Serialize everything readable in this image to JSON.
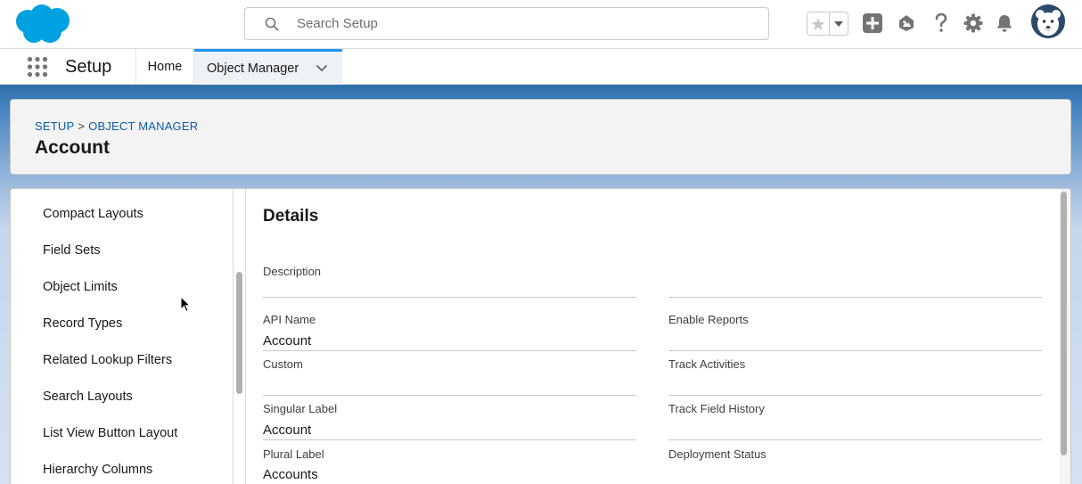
{
  "header": {
    "search": {
      "placeholder": "Search Setup",
      "value": ""
    },
    "icons": [
      "salesforce-cloud-logo",
      "search-icon",
      "star-icon",
      "chevron-down-icon",
      "plus-icon",
      "trailhead-icon",
      "help-icon",
      "gear-icon",
      "bell-icon",
      "bear-avatar"
    ]
  },
  "context": {
    "app_name": "Setup",
    "tabs": [
      {
        "label": "Home"
      },
      {
        "label": "Object Manager"
      }
    ]
  },
  "page_header": {
    "breadcrumb": [
      "SETUP",
      "OBJECT MANAGER"
    ],
    "breadcrumb_sep": ">",
    "title": "Account"
  },
  "sidebar": {
    "items": [
      "Compact Layouts",
      "Field Sets",
      "Object Limits",
      "Record Types",
      "Related Lookup Filters",
      "Search Layouts",
      "List View Button Layout",
      "Hierarchy Columns"
    ]
  },
  "details": {
    "title": "Details",
    "left": [
      {
        "label": "Description",
        "value": ""
      },
      {
        "label": "API Name",
        "value": "Account"
      },
      {
        "label": "Custom",
        "value": ""
      },
      {
        "label": "Singular Label",
        "value": "Account"
      },
      {
        "label": "Plural Label",
        "value": "Accounts"
      }
    ],
    "right": [
      {
        "label": "Enable Reports",
        "value": ""
      },
      {
        "label": "Track Activities",
        "value": ""
      },
      {
        "label": "Track Field History",
        "value": ""
      },
      {
        "label": "Deployment Status",
        "value": ""
      }
    ]
  },
  "colors": {
    "brand_blue": "#00a1e0",
    "link": "#0b5cab",
    "band": "#3f7fbf"
  }
}
